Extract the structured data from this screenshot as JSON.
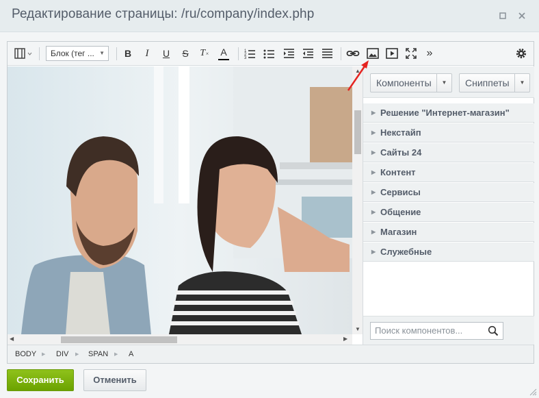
{
  "dialog": {
    "title": "Редактирование страницы: /ru/company/index.php"
  },
  "toolbar": {
    "block_select": "Блок (тег ...",
    "bold": "B",
    "italic": "I",
    "underline": "U",
    "strike": "S",
    "clear_format": "T",
    "font_color": "A",
    "more": "»"
  },
  "side": {
    "components_button": "Компоненты",
    "snippets_button": "Сниппеты",
    "categories": [
      {
        "label": "Решение \"Интернет-магазин\""
      },
      {
        "label": "Некстайп"
      },
      {
        "label": "Сайты 24"
      },
      {
        "label": "Контент"
      },
      {
        "label": "Сервисы"
      },
      {
        "label": "Общение"
      },
      {
        "label": "Магазин"
      },
      {
        "label": "Служебные"
      }
    ],
    "search_placeholder": "Поиск компонентов..."
  },
  "statusbar": {
    "crumbs": [
      "BODY",
      "DIV",
      "SPAN",
      "A"
    ]
  },
  "footer": {
    "save_label": "Сохранить",
    "cancel_label": "Отменить"
  },
  "colors": {
    "accent_green": "#7bb30f",
    "annotation_arrow": "#e52420",
    "text": "#535c69"
  }
}
